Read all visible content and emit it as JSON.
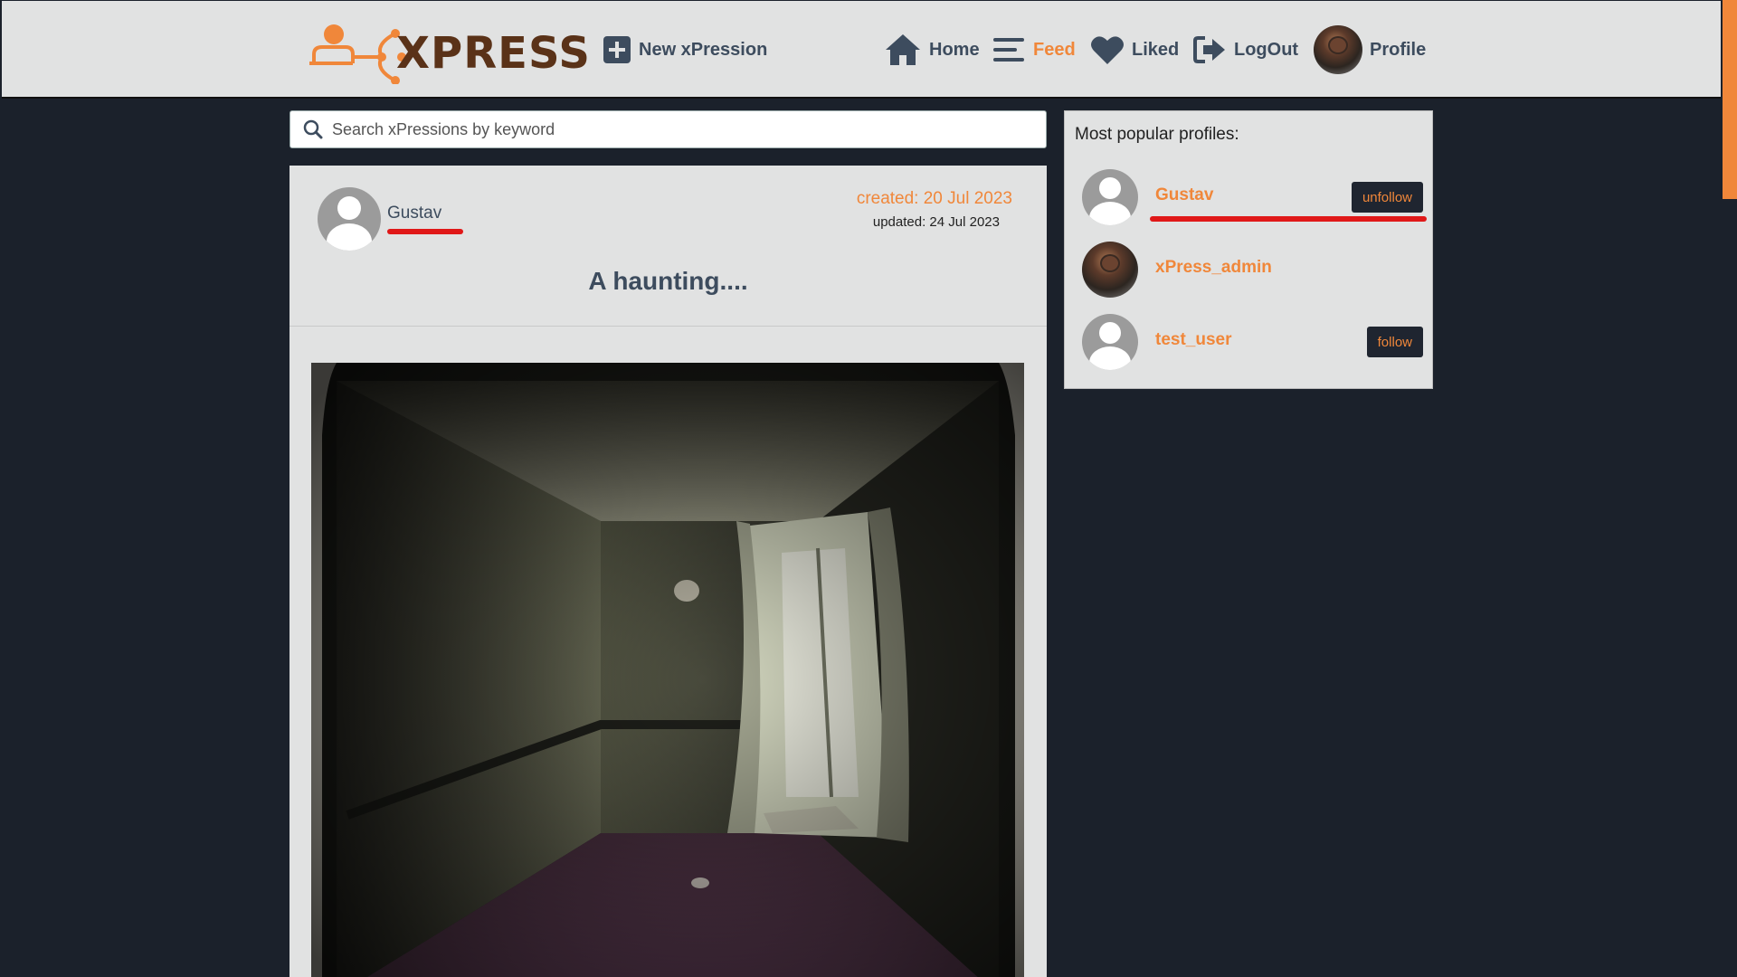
{
  "brand": {
    "name": "XPRESS",
    "accent": "#f0873a",
    "dark": "#1b212b"
  },
  "nav": {
    "new_label": "New xPression",
    "home_label": "Home",
    "feed_label": "Feed",
    "liked_label": "Liked",
    "logout_label": "LogOut",
    "profile_label": "Profile",
    "active": "Feed"
  },
  "search": {
    "placeholder": "Search xPressions by keyword",
    "value": ""
  },
  "post": {
    "author": "Gustav",
    "created": "created: 20 Jul 2023",
    "updated": "updated: 24 Jul 2023",
    "title": "A haunting....",
    "image": "haunted-room-photo"
  },
  "sidebar": {
    "title": "Most popular profiles:",
    "profiles": [
      {
        "name": "Gustav",
        "button": "unfollow",
        "avatar": "default-avatar"
      },
      {
        "name": "xPress_admin",
        "button": "",
        "avatar": "robot-avatar"
      },
      {
        "name": "test_user",
        "button": "follow",
        "avatar": "default-avatar"
      }
    ]
  }
}
